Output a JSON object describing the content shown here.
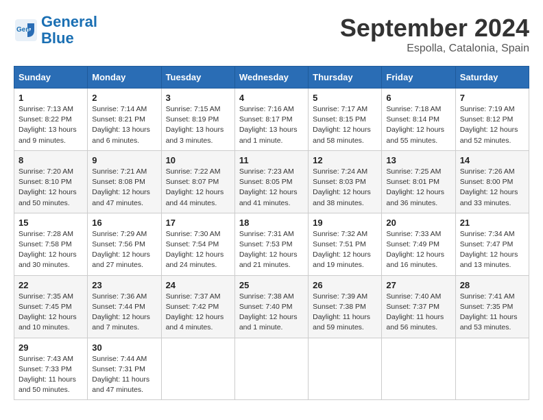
{
  "header": {
    "logo_line1": "General",
    "logo_line2": "Blue",
    "month_title": "September 2024",
    "location": "Espolla, Catalonia, Spain"
  },
  "days_of_week": [
    "Sunday",
    "Monday",
    "Tuesday",
    "Wednesday",
    "Thursday",
    "Friday",
    "Saturday"
  ],
  "weeks": [
    [
      {
        "day": "1",
        "info": "Sunrise: 7:13 AM\nSunset: 8:22 PM\nDaylight: 13 hours\nand 9 minutes."
      },
      {
        "day": "2",
        "info": "Sunrise: 7:14 AM\nSunset: 8:21 PM\nDaylight: 13 hours\nand 6 minutes."
      },
      {
        "day": "3",
        "info": "Sunrise: 7:15 AM\nSunset: 8:19 PM\nDaylight: 13 hours\nand 3 minutes."
      },
      {
        "day": "4",
        "info": "Sunrise: 7:16 AM\nSunset: 8:17 PM\nDaylight: 13 hours\nand 1 minute."
      },
      {
        "day": "5",
        "info": "Sunrise: 7:17 AM\nSunset: 8:15 PM\nDaylight: 12 hours\nand 58 minutes."
      },
      {
        "day": "6",
        "info": "Sunrise: 7:18 AM\nSunset: 8:14 PM\nDaylight: 12 hours\nand 55 minutes."
      },
      {
        "day": "7",
        "info": "Sunrise: 7:19 AM\nSunset: 8:12 PM\nDaylight: 12 hours\nand 52 minutes."
      }
    ],
    [
      {
        "day": "8",
        "info": "Sunrise: 7:20 AM\nSunset: 8:10 PM\nDaylight: 12 hours\nand 50 minutes."
      },
      {
        "day": "9",
        "info": "Sunrise: 7:21 AM\nSunset: 8:08 PM\nDaylight: 12 hours\nand 47 minutes."
      },
      {
        "day": "10",
        "info": "Sunrise: 7:22 AM\nSunset: 8:07 PM\nDaylight: 12 hours\nand 44 minutes."
      },
      {
        "day": "11",
        "info": "Sunrise: 7:23 AM\nSunset: 8:05 PM\nDaylight: 12 hours\nand 41 minutes."
      },
      {
        "day": "12",
        "info": "Sunrise: 7:24 AM\nSunset: 8:03 PM\nDaylight: 12 hours\nand 38 minutes."
      },
      {
        "day": "13",
        "info": "Sunrise: 7:25 AM\nSunset: 8:01 PM\nDaylight: 12 hours\nand 36 minutes."
      },
      {
        "day": "14",
        "info": "Sunrise: 7:26 AM\nSunset: 8:00 PM\nDaylight: 12 hours\nand 33 minutes."
      }
    ],
    [
      {
        "day": "15",
        "info": "Sunrise: 7:28 AM\nSunset: 7:58 PM\nDaylight: 12 hours\nand 30 minutes."
      },
      {
        "day": "16",
        "info": "Sunrise: 7:29 AM\nSunset: 7:56 PM\nDaylight: 12 hours\nand 27 minutes."
      },
      {
        "day": "17",
        "info": "Sunrise: 7:30 AM\nSunset: 7:54 PM\nDaylight: 12 hours\nand 24 minutes."
      },
      {
        "day": "18",
        "info": "Sunrise: 7:31 AM\nSunset: 7:53 PM\nDaylight: 12 hours\nand 21 minutes."
      },
      {
        "day": "19",
        "info": "Sunrise: 7:32 AM\nSunset: 7:51 PM\nDaylight: 12 hours\nand 19 minutes."
      },
      {
        "day": "20",
        "info": "Sunrise: 7:33 AM\nSunset: 7:49 PM\nDaylight: 12 hours\nand 16 minutes."
      },
      {
        "day": "21",
        "info": "Sunrise: 7:34 AM\nSunset: 7:47 PM\nDaylight: 12 hours\nand 13 minutes."
      }
    ],
    [
      {
        "day": "22",
        "info": "Sunrise: 7:35 AM\nSunset: 7:45 PM\nDaylight: 12 hours\nand 10 minutes."
      },
      {
        "day": "23",
        "info": "Sunrise: 7:36 AM\nSunset: 7:44 PM\nDaylight: 12 hours\nand 7 minutes."
      },
      {
        "day": "24",
        "info": "Sunrise: 7:37 AM\nSunset: 7:42 PM\nDaylight: 12 hours\nand 4 minutes."
      },
      {
        "day": "25",
        "info": "Sunrise: 7:38 AM\nSunset: 7:40 PM\nDaylight: 12 hours\nand 1 minute."
      },
      {
        "day": "26",
        "info": "Sunrise: 7:39 AM\nSunset: 7:38 PM\nDaylight: 11 hours\nand 59 minutes."
      },
      {
        "day": "27",
        "info": "Sunrise: 7:40 AM\nSunset: 7:37 PM\nDaylight: 11 hours\nand 56 minutes."
      },
      {
        "day": "28",
        "info": "Sunrise: 7:41 AM\nSunset: 7:35 PM\nDaylight: 11 hours\nand 53 minutes."
      }
    ],
    [
      {
        "day": "29",
        "info": "Sunrise: 7:43 AM\nSunset: 7:33 PM\nDaylight: 11 hours\nand 50 minutes."
      },
      {
        "day": "30",
        "info": "Sunrise: 7:44 AM\nSunset: 7:31 PM\nDaylight: 11 hours\nand 47 minutes."
      },
      {
        "day": "",
        "info": ""
      },
      {
        "day": "",
        "info": ""
      },
      {
        "day": "",
        "info": ""
      },
      {
        "day": "",
        "info": ""
      },
      {
        "day": "",
        "info": ""
      }
    ]
  ]
}
